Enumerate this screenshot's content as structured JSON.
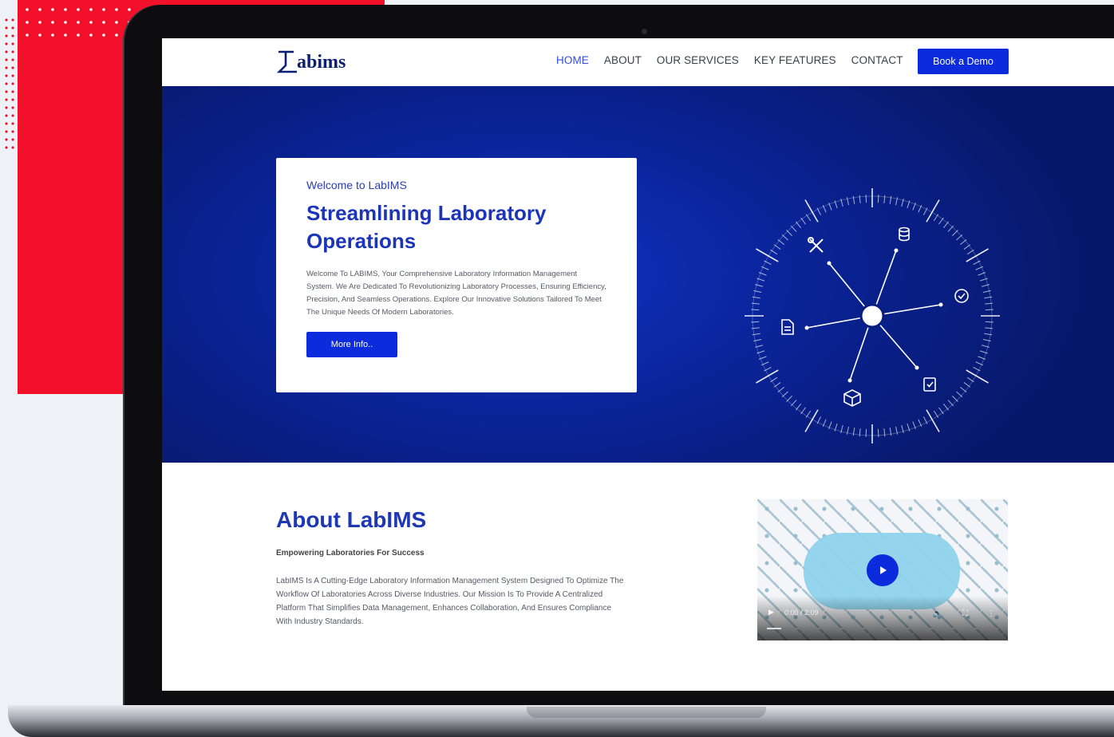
{
  "brand": {
    "logo_text": "abims",
    "accent": "#0b2bdc",
    "hero_bg": "#0a249a",
    "red": "#f2102a"
  },
  "nav": {
    "items": [
      "HOME",
      "ABOUT",
      "OUR SERVICES",
      "KEY FEATURES",
      "CONTACT"
    ],
    "active": "HOME",
    "cta": "Book a Demo"
  },
  "hero": {
    "welcome": "Welcome to LabIMS",
    "title_line1": "Streamlining Laboratory",
    "title_line2": "Operations",
    "description": "Welcome To LABIMS, Your Comprehensive Laboratory Information Management System. We Are Dedicated To Revolutionizing Laboratory Processes, Ensuring Efficiency, Precision, And Seamless Operations. Explore Our Innovative Solutions Tailored To Meet The Unique Needs Of Modern Laboratories.",
    "button": "More Info..",
    "dial_icons": [
      "tools-icon",
      "database-icon",
      "check-circle-icon",
      "clipboard-icon",
      "box-icon",
      "document-icon"
    ]
  },
  "about": {
    "title": "About LabIMS",
    "subtitle": "Empowering Laboratories For Success",
    "description": "LabIMS Is A Cutting-Edge Laboratory Information Management System Designed To Optimize The Workflow Of Laboratories Across Diverse Industries. Our Mission Is To Provide A Centralized Platform That Simplifies Data Management, Enhances Collaboration, And Ensures Compliance With Industry Standards."
  },
  "video": {
    "time": "0:00 / 2:09"
  }
}
